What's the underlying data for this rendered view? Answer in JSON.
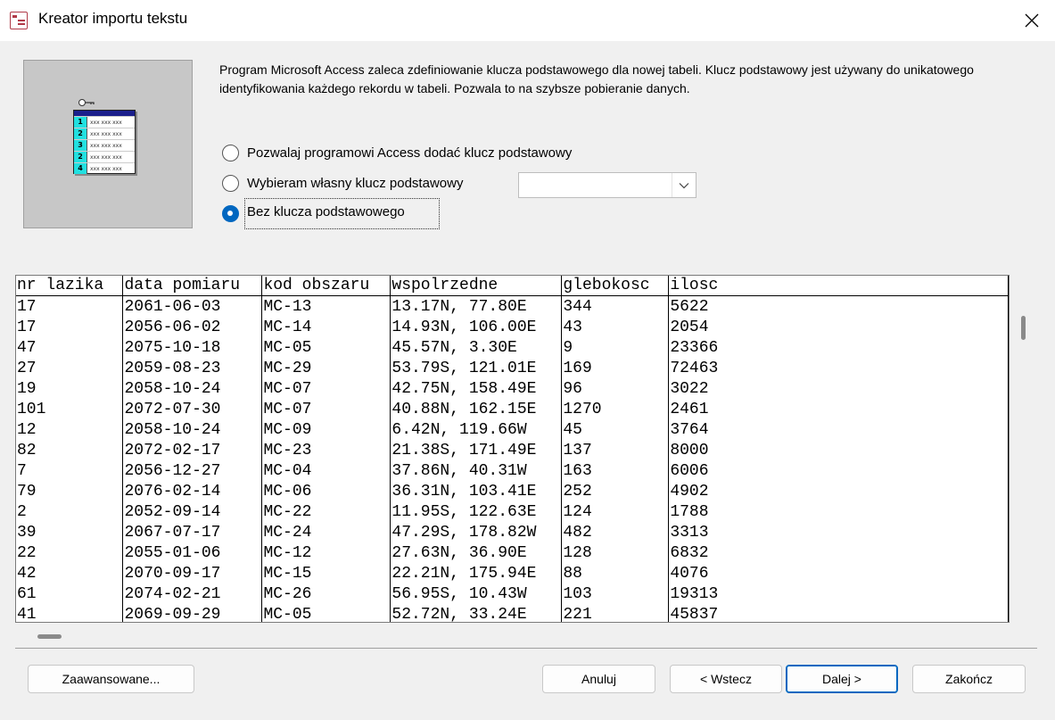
{
  "window": {
    "title": "Kreator importu tekstu"
  },
  "icons": {
    "app": "access-form-icon",
    "close": "close-icon",
    "key": "key-icon",
    "dropdown": "chevron-down-icon"
  },
  "illustration": {
    "row_numbers": [
      "1",
      "2",
      "3",
      "2",
      "4"
    ],
    "cell_text": "xxx xxx xxx"
  },
  "description": "Program Microsoft Access zaleca zdefiniowanie klucza podstawowego dla  nowej tabeli. Klucz podstawowy jest używany do unikatowego identyfikowania każdego rekordu w tabeli. Pozwala to na szybsze pobieranie danych.",
  "options": [
    {
      "label": "Pozwalaj programowi Access dodać klucz podstawowy",
      "selected": false
    },
    {
      "label": "Wybieram własny klucz podstawowy",
      "selected": false
    },
    {
      "label": "Bez klucza podstawowego",
      "selected": true
    }
  ],
  "key_field_select": {
    "value": ""
  },
  "preview": {
    "columns": [
      "nr lazika",
      "data pomiaru",
      "kod obszaru",
      "wspolrzedne",
      "glebokosc",
      "ilosc"
    ],
    "rows": [
      [
        "17",
        "2061-06-03",
        "MC-13",
        "13.17N, 77.80E",
        "344",
        "5622"
      ],
      [
        "17",
        "2056-06-02",
        "MC-14",
        "14.93N, 106.00E",
        "43",
        "2054"
      ],
      [
        "47",
        "2075-10-18",
        "MC-05",
        "45.57N, 3.30E",
        "9",
        "23366"
      ],
      [
        "27",
        "2059-08-23",
        "MC-29",
        "53.79S, 121.01E",
        "169",
        "72463"
      ],
      [
        "19",
        "2058-10-24",
        "MC-07",
        "42.75N, 158.49E",
        "96",
        "3022"
      ],
      [
        "101",
        "2072-07-30",
        "MC-07",
        "40.88N, 162.15E",
        "1270",
        "2461"
      ],
      [
        "12",
        "2058-10-24",
        "MC-09",
        "6.42N, 119.66W",
        "45",
        "3764"
      ],
      [
        "82",
        "2072-02-17",
        "MC-23",
        "21.38S, 171.49E",
        "137",
        "8000"
      ],
      [
        "7",
        "2056-12-27",
        "MC-04",
        "37.86N, 40.31W",
        "163",
        "6006"
      ],
      [
        "79",
        "2076-02-14",
        "MC-06",
        "36.31N, 103.41E",
        "252",
        "4902"
      ],
      [
        "2",
        "2052-09-14",
        "MC-22",
        "11.95S, 122.63E",
        "124",
        "1788"
      ],
      [
        "39",
        "2067-07-17",
        "MC-24",
        "47.29S, 178.82W",
        "482",
        "3313"
      ],
      [
        "22",
        "2055-01-06",
        "MC-12",
        "27.63N, 36.90E",
        "128",
        "6832"
      ],
      [
        "42",
        "2070-09-17",
        "MC-15",
        "22.21N, 175.94E",
        "88",
        "4076"
      ],
      [
        "61",
        "2074-02-21",
        "MC-26",
        "56.95S, 10.43W",
        "103",
        "19313"
      ],
      [
        "41",
        "2069-09-29",
        "MC-05",
        "52.72N, 33.24E",
        "221",
        "45837"
      ]
    ]
  },
  "buttons": {
    "advanced": "Zaawansowane...",
    "cancel": "Anuluj",
    "back": "< Wstecz",
    "next": "Dalej >",
    "finish": "Zakończ"
  }
}
